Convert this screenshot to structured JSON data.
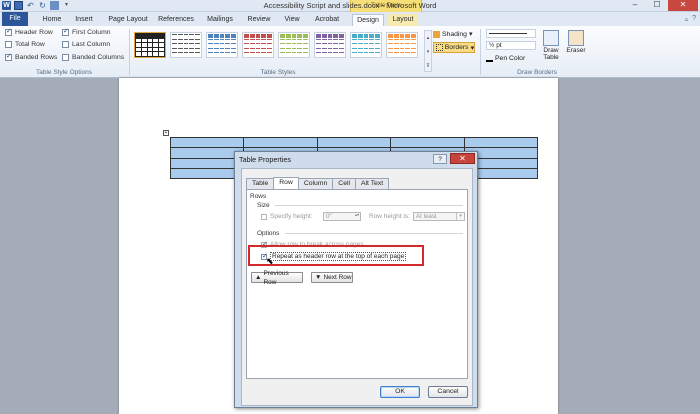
{
  "window": {
    "title": "Accessibility Script and slides.docx - Microsoft Word",
    "contextual_group": "Table Tools",
    "minimize": "–",
    "maximize": "☐",
    "close": "✕"
  },
  "qat": {
    "word_letter": "W",
    "undo": "↶",
    "redo": "↻",
    "more": "▾"
  },
  "ribbon_tabs": [
    "File",
    "Home",
    "Insert",
    "Page Layout",
    "References",
    "Mailings",
    "Review",
    "View",
    "Acrobat",
    "Design",
    "Layout"
  ],
  "ribbon_right": {
    "collapse": "▵",
    "help": "?"
  },
  "table_style_options": {
    "label": "Table Style Options",
    "items": [
      {
        "label": "Header Row",
        "checked": true
      },
      {
        "label": "First Column",
        "checked": true
      },
      {
        "label": "Total Row",
        "checked": false
      },
      {
        "label": "Last Column",
        "checked": false
      },
      {
        "label": "Banded Rows",
        "checked": true
      },
      {
        "label": "Banded Columns",
        "checked": false
      }
    ]
  },
  "table_styles": {
    "label": "Table Styles",
    "thumb_colors": [
      "#1f1f1f",
      "#5a5a5a",
      "#4f81bd",
      "#c0504d",
      "#9bbb59",
      "#8064a2",
      "#4bacc6",
      "#f79646"
    ]
  },
  "shading": {
    "label": "Shading",
    "arrow": "▾"
  },
  "borders": {
    "label": "Borders",
    "arrow": "▾"
  },
  "draw_borders": {
    "label": "Draw Borders",
    "pen_weight": "½ pt",
    "pen_color": "Pen Color",
    "draw_table": "Draw Table",
    "eraser": "Eraser"
  },
  "dialog": {
    "title": "Table Properties",
    "help": "?",
    "close": "✕",
    "tabs": [
      "Table",
      "Row",
      "Column",
      "Cell",
      "Alt Text"
    ],
    "active_tab": "Row",
    "rows_label": "Rows",
    "size_label": "Size",
    "specify_height": "Specify height:",
    "height_value": "0\"",
    "row_height_is": "Row height is:",
    "row_height_option": "At least",
    "options_label": "Options",
    "allow_break": "Allow row to break across pages",
    "repeat_header": "Repeat as header row at the top of each page",
    "prev_row": "Previous Row",
    "next_row": "Next Row",
    "prev_arrow": "▲",
    "next_arrow": "▼",
    "ok": "OK",
    "cancel": "Cancel"
  }
}
